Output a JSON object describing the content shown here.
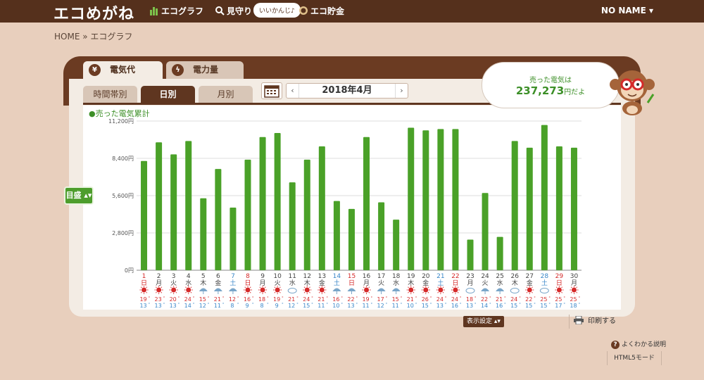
{
  "header": {
    "logo": "エコめがね",
    "nav": [
      {
        "label": "エコグラフ",
        "icon": "bar-chart-icon"
      },
      {
        "label": "見守り",
        "icon": "search-icon"
      },
      {
        "label": "エコ貯金",
        "icon": "coin-icon"
      }
    ],
    "bubble": "いいかんじ♪",
    "user": "NO NAME ▾"
  },
  "breadcrumb": "HOME » エコグラフ",
  "main_tabs": [
    {
      "label": "電気代",
      "icon": "yen-icon",
      "active": true
    },
    {
      "label": "電力量",
      "icon": "lightning-icon",
      "active": false
    }
  ],
  "sub_tabs": [
    {
      "label": "時間帯別",
      "active": false
    },
    {
      "label": "日別",
      "active": true
    },
    {
      "label": "月別",
      "active": false
    }
  ],
  "month_nav": {
    "prev": "‹",
    "label": "2018年4月",
    "next": "›"
  },
  "sold_box": {
    "line1": "売った電気は",
    "amount": "237,273",
    "suffix": "円だよ"
  },
  "legend": "●売った電気累計",
  "scale_button": "目盛 ▴▾",
  "display_settings": "表示設定 ▴▾",
  "print": "印刷する",
  "help": "よくわかる説明",
  "html5": "HTML5モード",
  "colors": {
    "bar": "#4aa128",
    "brown": "#5f3620",
    "sun": "#d52a2a",
    "sat": "#3a87c9",
    "sun_day": "#d52a2a",
    "hi": "#d52a2a",
    "lo": "#3a87c9"
  },
  "chart_data": {
    "type": "bar",
    "ylim": [
      0,
      11200
    ],
    "yticks": [
      "0円",
      "2,800円",
      "5,600円",
      "8,400円",
      "11,200円"
    ],
    "yticks_values": [
      0,
      2800,
      5600,
      8400,
      11200
    ],
    "series": [
      {
        "name": "売った電気累計"
      }
    ],
    "days": [
      {
        "d": "1",
        "w": "日",
        "v": 8200,
        "weather": "sun",
        "hi": "19",
        "lo": "13"
      },
      {
        "d": "2",
        "w": "月",
        "v": 9600,
        "weather": "sun",
        "hi": "23",
        "lo": "13"
      },
      {
        "d": "3",
        "w": "火",
        "v": 8700,
        "weather": "sun",
        "hi": "20",
        "lo": "13"
      },
      {
        "d": "4",
        "w": "水",
        "v": 9700,
        "weather": "sun",
        "hi": "24",
        "lo": "14"
      },
      {
        "d": "5",
        "w": "木",
        "v": 5400,
        "weather": "rain",
        "hi": "15",
        "lo": "12"
      },
      {
        "d": "6",
        "w": "金",
        "v": 7600,
        "weather": "rain",
        "hi": "21",
        "lo": "11"
      },
      {
        "d": "7",
        "w": "土",
        "v": 4700,
        "weather": "rain",
        "hi": "12",
        "lo": "8"
      },
      {
        "d": "8",
        "w": "日",
        "v": 8300,
        "weather": "sun",
        "hi": "16",
        "lo": "9"
      },
      {
        "d": "9",
        "w": "月",
        "v": 10000,
        "weather": "sun",
        "hi": "18",
        "lo": "8"
      },
      {
        "d": "10",
        "w": "火",
        "v": 10300,
        "weather": "sun",
        "hi": "19",
        "lo": "9"
      },
      {
        "d": "11",
        "w": "水",
        "v": 6600,
        "weather": "cloud",
        "hi": "21",
        "lo": "12"
      },
      {
        "d": "12",
        "w": "木",
        "v": 8300,
        "weather": "sun",
        "hi": "24",
        "lo": "15"
      },
      {
        "d": "13",
        "w": "金",
        "v": 9300,
        "weather": "sun",
        "hi": "21",
        "lo": "11"
      },
      {
        "d": "14",
        "w": "土",
        "v": 5200,
        "weather": "rain",
        "hi": "16",
        "lo": "10"
      },
      {
        "d": "15",
        "w": "日",
        "v": 4600,
        "weather": "rain",
        "hi": "22",
        "lo": "13"
      },
      {
        "d": "16",
        "w": "月",
        "v": 10000,
        "weather": "sun",
        "hi": "19",
        "lo": "11"
      },
      {
        "d": "17",
        "w": "火",
        "v": 5100,
        "weather": "rain",
        "hi": "17",
        "lo": "12"
      },
      {
        "d": "18",
        "w": "水",
        "v": 3800,
        "weather": "rain",
        "hi": "15",
        "lo": "11"
      },
      {
        "d": "19",
        "w": "木",
        "v": 10700,
        "weather": "sun",
        "hi": "21",
        "lo": "10"
      },
      {
        "d": "20",
        "w": "金",
        "v": 10500,
        "weather": "sun",
        "hi": "26",
        "lo": "15"
      },
      {
        "d": "21",
        "w": "土",
        "v": 10600,
        "weather": "sun",
        "hi": "24",
        "lo": "13"
      },
      {
        "d": "22",
        "w": "日",
        "v": 10600,
        "weather": "sun",
        "hi": "24",
        "lo": "16"
      },
      {
        "d": "23",
        "w": "月",
        "v": 2300,
        "weather": "cloud",
        "hi": "18",
        "lo": "13"
      },
      {
        "d": "24",
        "w": "火",
        "v": 5800,
        "weather": "rain",
        "hi": "22",
        "lo": "14"
      },
      {
        "d": "25",
        "w": "水",
        "v": 2500,
        "weather": "rain",
        "hi": "21",
        "lo": "16"
      },
      {
        "d": "26",
        "w": "木",
        "v": 9700,
        "weather": "cloud",
        "hi": "24",
        "lo": "15"
      },
      {
        "d": "27",
        "w": "金",
        "v": 9200,
        "weather": "sun",
        "hi": "22",
        "lo": "15"
      },
      {
        "d": "28",
        "w": "土",
        "v": 10900,
        "weather": "cloud",
        "hi": "25",
        "lo": "15"
      },
      {
        "d": "29",
        "w": "日",
        "v": 9300,
        "weather": "sun",
        "hi": "25",
        "lo": "17"
      },
      {
        "d": "30",
        "w": "月",
        "v": 9200,
        "weather": "sun",
        "hi": "25",
        "lo": "18"
      }
    ]
  }
}
